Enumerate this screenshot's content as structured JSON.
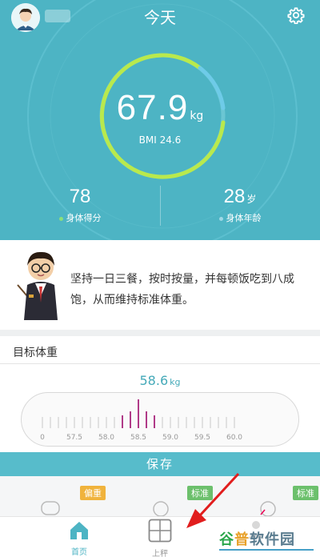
{
  "header": {
    "title": "今天",
    "weight_value": "67.9",
    "weight_unit": "kg",
    "bmi_label": "BMI 24.6",
    "body_score": {
      "value": "78",
      "label": "身体得分",
      "dot_color": "#8be07a"
    },
    "body_age": {
      "value": "28",
      "unit": "岁",
      "label": "身体年龄",
      "dot_color": "#9fd8e6"
    },
    "ring_colors": {
      "progress": "#b9e94d",
      "track": "#5fbed0",
      "accent": "#6ecbe8"
    }
  },
  "tip": {
    "text": "坚持一日三餐，按时按量，并每顿饭吃到八成饱，从而维持标准体重。"
  },
  "target": {
    "title": "目标体重",
    "value": "58.6",
    "unit": "kg",
    "ruler_labels": [
      "0",
      "57.5",
      "58.0",
      "58.5",
      "59.0",
      "59.5",
      "60.0"
    ],
    "accent_color": "#46aab9",
    "highlight_color": "#b03a88"
  },
  "save_label": "保存",
  "strip_badges": [
    "偏重",
    "标准",
    "标准"
  ],
  "tabs": [
    {
      "label": "首页",
      "active": true
    },
    {
      "label": "上秤",
      "active": false
    },
    {
      "label": "",
      "active": false
    }
  ],
  "watermark": "谷普软件园"
}
